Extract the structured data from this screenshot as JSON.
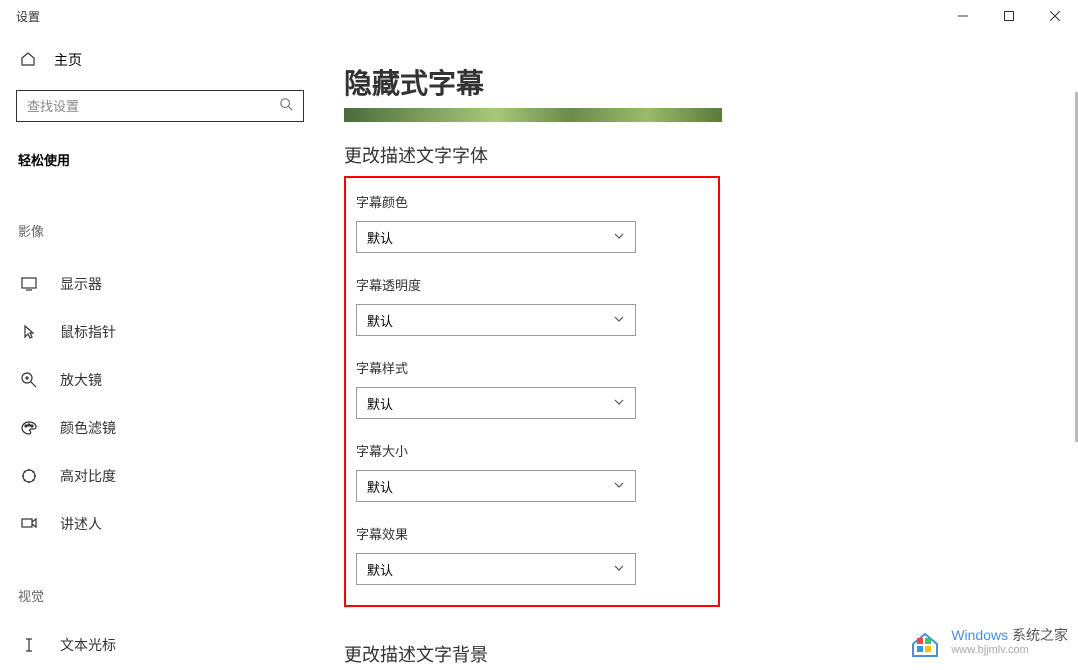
{
  "titlebar": {
    "title": "设置"
  },
  "sidebar": {
    "home": "主页",
    "search_placeholder": "查找设置",
    "active_page": "轻松使用",
    "group1": "影像",
    "items": [
      {
        "label": "显示器"
      },
      {
        "label": "鼠标指针"
      },
      {
        "label": "放大镜"
      },
      {
        "label": "颜色滤镜"
      },
      {
        "label": "高对比度"
      },
      {
        "label": "讲述人"
      }
    ],
    "group2": "视觉",
    "items2": [
      {
        "label": "文本光标"
      }
    ]
  },
  "main": {
    "title": "隐藏式字幕",
    "section1": "更改描述文字字体",
    "settings": [
      {
        "label": "字幕颜色",
        "value": "默认"
      },
      {
        "label": "字幕透明度",
        "value": "默认"
      },
      {
        "label": "字幕样式",
        "value": "默认"
      },
      {
        "label": "字幕大小",
        "value": "默认"
      },
      {
        "label": "字幕效果",
        "value": "默认"
      }
    ],
    "section2": "更改描述文字背景"
  },
  "watermark": {
    "brand_blue": "Windows",
    "brand_black": "系统之家",
    "url": "www.bjjmlv.com"
  }
}
